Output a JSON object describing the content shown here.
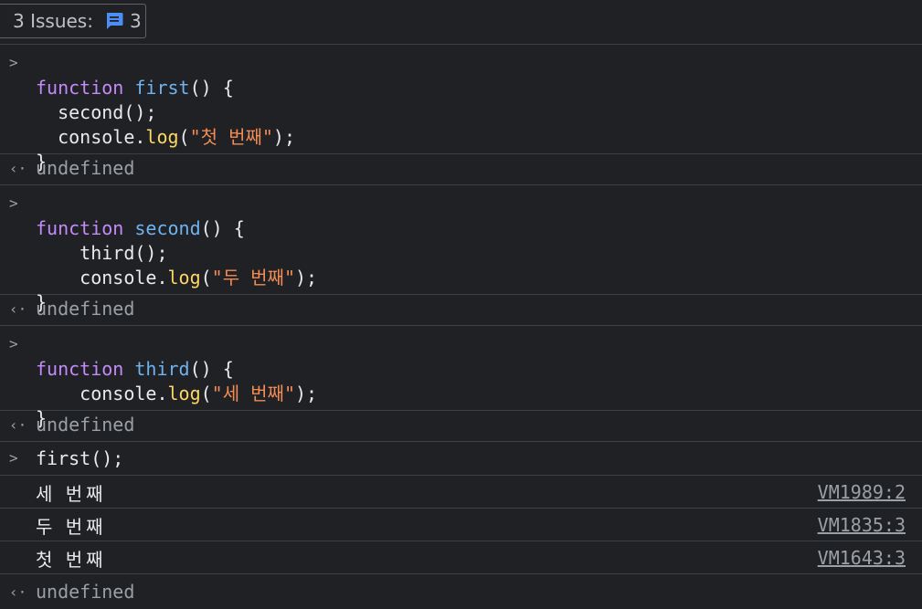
{
  "toolbar": {
    "issues_label": "3 Issues:",
    "issues_count": "3"
  },
  "entries": [
    {
      "type": "input",
      "lines": [
        {
          "kw": "function",
          "name": "first",
          "rest": "() {"
        },
        {
          "indent": "  ",
          "call": "second",
          "tail": "();"
        },
        {
          "indent": "  ",
          "obj": "console.",
          "meth": "log",
          "open": "(",
          "str": "\"첫 번째\"",
          "close": ");"
        },
        {
          "plain": "}"
        }
      ],
      "result": "undefined"
    },
    {
      "type": "input",
      "lines": [
        {
          "kw": "function",
          "name": "second",
          "rest": "() {"
        },
        {
          "indent": "    ",
          "call": "third",
          "tail": "();"
        },
        {
          "indent": "    ",
          "obj": "console.",
          "meth": "log",
          "open": "(",
          "str": "\"두 번째\"",
          "close": ");"
        },
        {
          "plain": "}"
        }
      ],
      "result": "undefined"
    },
    {
      "type": "input",
      "lines": [
        {
          "kw": "function",
          "name": "third",
          "rest": "() {"
        },
        {
          "indent": "    ",
          "obj": "console.",
          "meth": "log",
          "open": "(",
          "str": "\"세 번째\"",
          "close": ");"
        },
        {
          "plain": "}"
        }
      ],
      "result": "undefined"
    }
  ],
  "call_input": "first();",
  "logs": [
    {
      "text": "세 번째",
      "source": "VM1989:2"
    },
    {
      "text": "두 번째",
      "source": "VM1835:3"
    },
    {
      "text": "첫 번째",
      "source": "VM1643:3"
    }
  ],
  "final_result": "undefined",
  "icons": {
    "prompt": "chevron-right-icon",
    "result": "return-arrow-icon",
    "issues": "message-icon"
  },
  "colors": {
    "background": "#202124",
    "keyword": "#c58af9",
    "function_name": "#6fb3f0",
    "string": "#f28b54",
    "method": "#fdd663",
    "issue_icon": "#4c8df6"
  }
}
